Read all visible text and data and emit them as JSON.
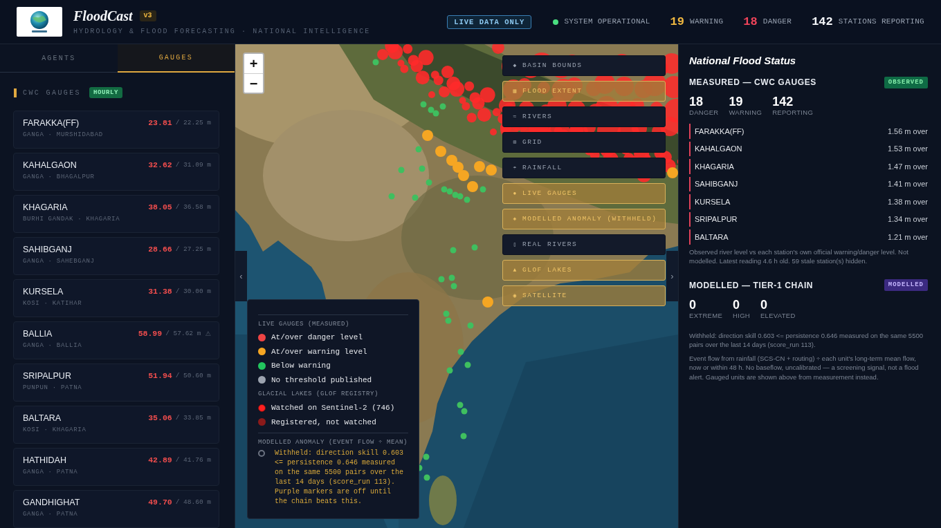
{
  "header": {
    "title": "FloodCast",
    "version": "v3",
    "subtitle": "HYDROLOGY & FLOOD FORECASTING · NATIONAL INTELLIGENCE",
    "live_badge": "LIVE DATA ONLY",
    "status": {
      "label": "SYSTEM OPERATIONAL",
      "operational": true
    },
    "counts": [
      {
        "kind": "warning",
        "value": "19",
        "label": "WARNING"
      },
      {
        "kind": "danger",
        "value": "18",
        "label": "DANGER"
      },
      {
        "kind": "total",
        "value": "142",
        "label": "STATIONS REPORTING"
      }
    ]
  },
  "sidebar": {
    "tabs": [
      {
        "label": "AGENTS",
        "selected": false
      },
      {
        "label": "GAUGES",
        "selected": true
      }
    ],
    "section": {
      "title": "CWC GAUGES",
      "badge": "HOURLY"
    },
    "gauges": [
      {
        "name": "FARAKKA(FF)",
        "place": "GANGA · MURSHIDABAD",
        "over_danger": true,
        "reading": "23.81",
        "threshold": "/ 22.25 m"
      },
      {
        "name": "KAHALGAON",
        "place": "GANGA · BHAGALPUR",
        "over_danger": true,
        "reading": "32.62",
        "threshold": "/ 31.09 m"
      },
      {
        "name": "KHAGARIA",
        "place": "BURHI GANDAK · KHAGARIA",
        "over_danger": true,
        "reading": "38.05",
        "threshold": "/ 36.58 m"
      },
      {
        "name": "SAHIBGANJ",
        "place": "GANGA · SAHEBGANJ",
        "over_danger": true,
        "reading": "28.66",
        "threshold": "/ 27.25 m"
      },
      {
        "name": "KURSELA",
        "place": "KOSI · KATIHAR",
        "over_danger": true,
        "reading": "31.38",
        "threshold": "/ 30.00 m"
      },
      {
        "name": "BALLIA",
        "place": "GANGA · BALLIA",
        "over_danger": true,
        "reading": "58.99",
        "threshold": "/ 57.62 m",
        "note": "⚠"
      },
      {
        "name": "SRIPALPUR",
        "place": "PUNPUN · PATNA",
        "over_danger": true,
        "reading": "51.94",
        "threshold": "/ 50.60 m"
      },
      {
        "name": "BALTARA",
        "place": "KOSI · KHAGARIA",
        "over_danger": true,
        "reading": "35.06",
        "threshold": "/ 33.85 m"
      },
      {
        "name": "HATHIDAH",
        "place": "GANGA · PATNA",
        "over_danger": true,
        "reading": "42.89",
        "threshold": "/ 41.76 m"
      },
      {
        "name": "GANDHIGHAT",
        "place": "GANGA · PATNA",
        "over_danger": true,
        "reading": "49.70",
        "threshold": "/ 48.60 m"
      }
    ]
  },
  "map": {
    "zoom_in": "+",
    "zoom_out": "−",
    "collapse_left": "‹",
    "collapse_right": "›",
    "layers": [
      {
        "glyph": "◆",
        "label": "BASIN BOUNDS",
        "on": false
      },
      {
        "glyph": "▦",
        "label": "FLOOD EXTENT",
        "on": true
      },
      {
        "glyph": "≈",
        "label": "RIVERS",
        "on": false
      },
      {
        "glyph": "⊞",
        "label": "GRID",
        "on": false
      },
      {
        "glyph": "☂",
        "label": "RAINFALL",
        "on": false
      },
      {
        "glyph": "●",
        "label": "LIVE GAUGES",
        "on": true
      },
      {
        "glyph": "◈",
        "label": "MODELLED ANOMALY (WITHHELD)",
        "on": true
      },
      {
        "glyph": "▯",
        "label": "REAL RIVERS",
        "on": false
      },
      {
        "glyph": "▲",
        "label": "GLOF LAKES",
        "on": true
      },
      {
        "glyph": "◉",
        "label": "SATELLITE",
        "on": true
      }
    ],
    "legend": {
      "sections": [
        {
          "rule_above": true,
          "title": "LIVE GAUGES (MEASURED)",
          "items": [
            {
              "kind": "dot",
              "color": "#ef4444",
              "label": "At/over danger level"
            },
            {
              "kind": "dot",
              "color": "#f5a623",
              "label": "At/over warning level"
            },
            {
              "kind": "dot",
              "color": "#22c55e",
              "label": "Below warning"
            },
            {
              "kind": "dot",
              "color": "#9ca3af",
              "label": "No threshold published"
            }
          ]
        },
        {
          "rule_above": false,
          "title": "GLACIAL LAKES (GLOF REGISTRY)",
          "items": [
            {
              "kind": "ringed",
              "color": "#ff2020",
              "label": "Watched on Sentinel-2 (746)"
            },
            {
              "kind": "dot",
              "color": "#8b1a1a",
              "label": "Registered, not watched"
            }
          ]
        },
        {
          "rule_above": true,
          "title": "MODELLED ANOMALY (EVENT FLOW ÷ MEAN)",
          "items": [
            {
              "kind": "hollow",
              "color": "#6b7280",
              "label": "Withheld: direction skill 0.603 <= persistence 0.646 measured on the same 5500 pairs over the last 14 days (score_run 113). Purple markers are off until the chain beats this."
            }
          ]
        }
      ]
    }
  },
  "status_panel": {
    "title": "National Flood Status",
    "sections": [
      {
        "kind": "observed",
        "heading": "MEASURED — CWC GAUGES",
        "badge": "OBSERVED",
        "stats": [
          {
            "value": "18",
            "label": "DANGER"
          },
          {
            "value": "19",
            "label": "WARNING"
          },
          {
            "value": "142",
            "label": "REPORTING"
          }
        ],
        "stations": [
          {
            "name": "FARAKKA(FF)",
            "excess": "1.56 m over"
          },
          {
            "name": "KAHALGAON",
            "excess": "1.53 m over"
          },
          {
            "name": "KHAGARIA",
            "excess": "1.47 m over"
          },
          {
            "name": "SAHIBGANJ",
            "excess": "1.41 m over"
          },
          {
            "name": "KURSELA",
            "excess": "1.38 m over"
          },
          {
            "name": "SRIPALPUR",
            "excess": "1.34 m over"
          },
          {
            "name": "BALTARA",
            "excess": "1.21 m over"
          }
        ],
        "notes": [
          "Observed river level vs each station's own official warning/danger level. Not modelled. Latest reading 4.6 h old. 59 stale station(s) hidden."
        ]
      },
      {
        "kind": "modelled",
        "heading": "MODELLED — TIER-1 CHAIN",
        "badge": "MODELLED",
        "stats": [
          {
            "value": "0",
            "label": "EXTREME"
          },
          {
            "value": "0",
            "label": "HIGH"
          },
          {
            "value": "0",
            "label": "ELEVATED"
          }
        ],
        "notes": [
          "Withheld: direction skill 0.603 <= persistence 0.646 measured on the same 5500 pairs over the last 14 days (score_run 113).",
          "Event flow from rainfall (SCS-CN + routing) ÷ each unit's long-term mean flow, now or within 48 h. No baseflow, uncalibrated — a screening signal, not a flood alert. Gauged units are shown above from measurement instead."
        ]
      }
    ]
  }
}
